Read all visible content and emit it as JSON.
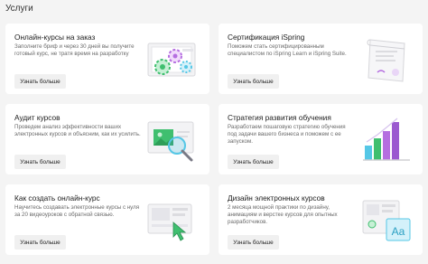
{
  "page": {
    "title": "Услуги"
  },
  "cards": [
    {
      "title": "Онлайн-курсы на заказ",
      "description": "Заполните бриф и через 30 дней вы получите готовый курс, не тратя время на разработку",
      "button": "Узнать больше",
      "icon": "gears-screen-icon"
    },
    {
      "title": "Сертификация iSpring",
      "description": "Поможем стать сертифицированным специалистом по iSpring Learn и iSpring Suite.",
      "button": "Узнать больше",
      "icon": "certificate-scroll-icon"
    },
    {
      "title": "Аудит курсов",
      "description": "Проведем анализ эффективности ваших электронных курсов и объясним, как их усилить.",
      "button": "Узнать больше",
      "icon": "magnifier-screen-icon"
    },
    {
      "title": "Стратегия развития обучения",
      "description": "Разработаем пошаговую стратегию обучения под задачи вашего бизнеса и поможем с ее запуском.",
      "button": "Узнать больше",
      "icon": "bar-chart-icon"
    },
    {
      "title": "Как создать онлайн-курс",
      "description": "Научитесь создавать электронные курсы с нуля за 20 видеоуроков с обратной связью.",
      "button": "Узнать больше",
      "icon": "video-lesson-icon"
    },
    {
      "title": "Дизайн электронных курсов",
      "description": "2 месяца мощной практики по дизайну, анимациям и верстке курсов для опытных разработчиков.",
      "button": "Узнать больше",
      "icon": "design-layout-icon"
    }
  ],
  "colors": {
    "background": "#f4f4f4",
    "card": "#ffffff",
    "button": "#f0f0f0",
    "accent_purple": "#a66ad6",
    "accent_green": "#3fbf6f",
    "accent_cyan": "#55c7e6"
  }
}
